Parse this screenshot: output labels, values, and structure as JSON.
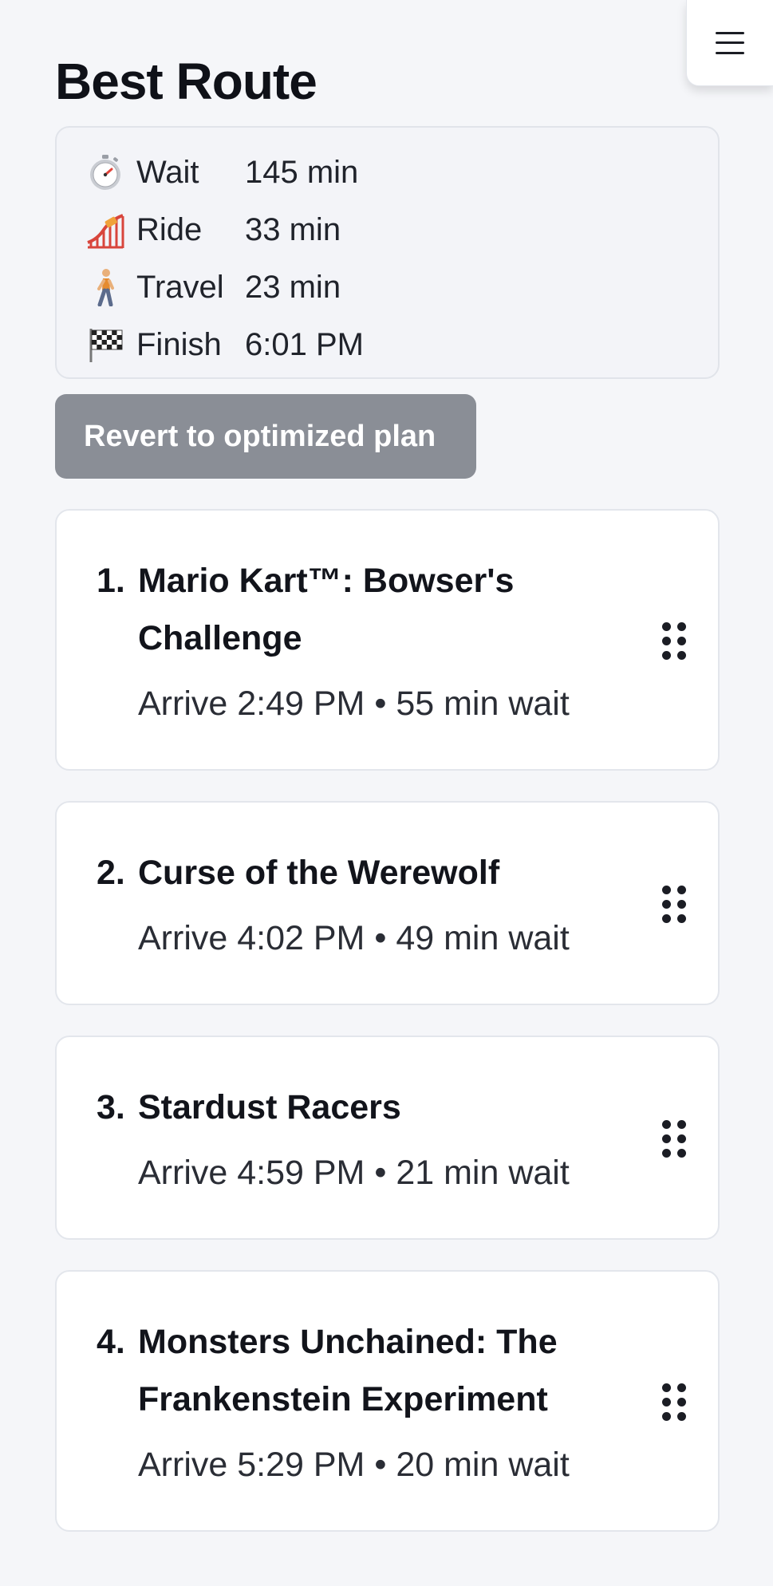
{
  "header": {
    "title": "Best Route",
    "menu_icon": "hamburger-menu-icon"
  },
  "summary": {
    "rows": [
      {
        "icon": "stopwatch-icon",
        "glyph": "⏱️",
        "label": "Wait",
        "value": "145 min"
      },
      {
        "icon": "roller-coaster-icon",
        "glyph": "🎢",
        "label": "Ride",
        "value": "33 min"
      },
      {
        "icon": "walking-person-icon",
        "glyph": "🚶",
        "label": "Travel",
        "value": "23 min"
      },
      {
        "icon": "checkered-flag-icon",
        "glyph": "🏁",
        "label": "Finish",
        "value": "6:01 PM"
      }
    ]
  },
  "actions": {
    "revert_label": "Revert to optimized plan"
  },
  "rides": [
    {
      "number": "1.",
      "name": "Mario Kart™: Bowser's Challenge",
      "meta": "Arrive 2:49 PM • 55 min wait"
    },
    {
      "number": "2.",
      "name": "Curse of the Werewolf",
      "meta": "Arrive 4:02 PM • 49 min wait"
    },
    {
      "number": "3.",
      "name": "Stardust Racers",
      "meta": "Arrive 4:59 PM • 21 min wait"
    },
    {
      "number": "4.",
      "name": "Monsters Unchained: The Frankenstein Experiment",
      "meta": "Arrive 5:29 PM • 20 min wait"
    }
  ],
  "colors": {
    "background": "#f5f6f9",
    "card": "#ffffff",
    "button": "#8a8e96",
    "text": "#14161d"
  }
}
